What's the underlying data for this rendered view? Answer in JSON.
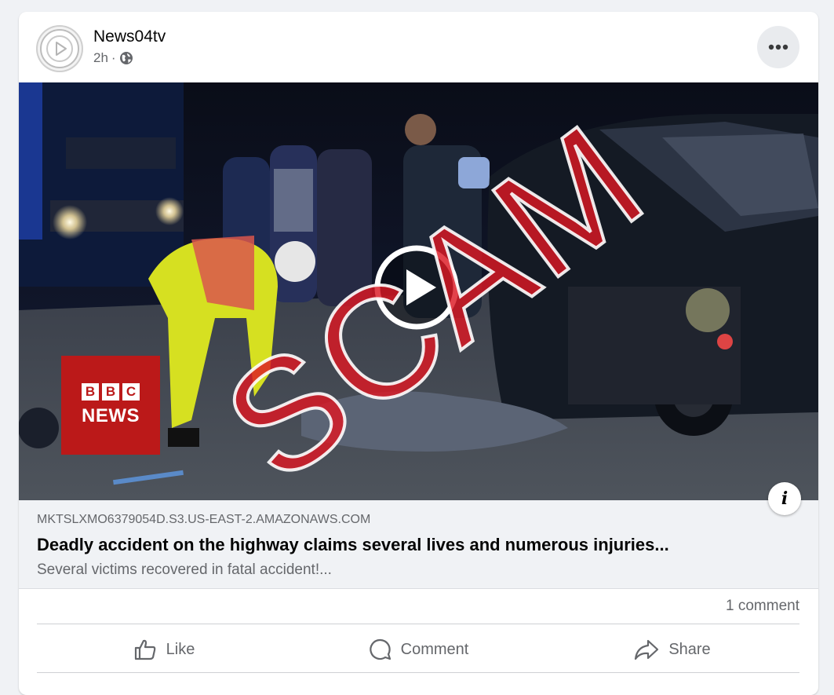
{
  "post": {
    "author": "News04tv",
    "time": "2h",
    "separator": "·",
    "video": {
      "overlay_text": "SCAM",
      "logo": {
        "blocks": [
          "B",
          "B",
          "C"
        ],
        "word": "NEWS"
      }
    },
    "link": {
      "domain": "MKTSLXMO6379054D.S3.US-EAST-2.AMAZONAWS.COM",
      "title": "Deadly accident on the highway claims several lives and numerous injuries...",
      "description": "Several victims recovered in fatal accident!..."
    },
    "comments_count": "1 comment",
    "actions": {
      "like": "Like",
      "comment": "Comment",
      "share": "Share"
    }
  },
  "colors": {
    "scam": "#dc1923",
    "bbc": "#bb1919",
    "muted_text": "#65676b"
  },
  "icons": [
    "avatar-play-icon",
    "globe-icon",
    "more-dots-icon",
    "play-icon",
    "info-icon",
    "like-icon",
    "comment-icon",
    "share-icon"
  ]
}
